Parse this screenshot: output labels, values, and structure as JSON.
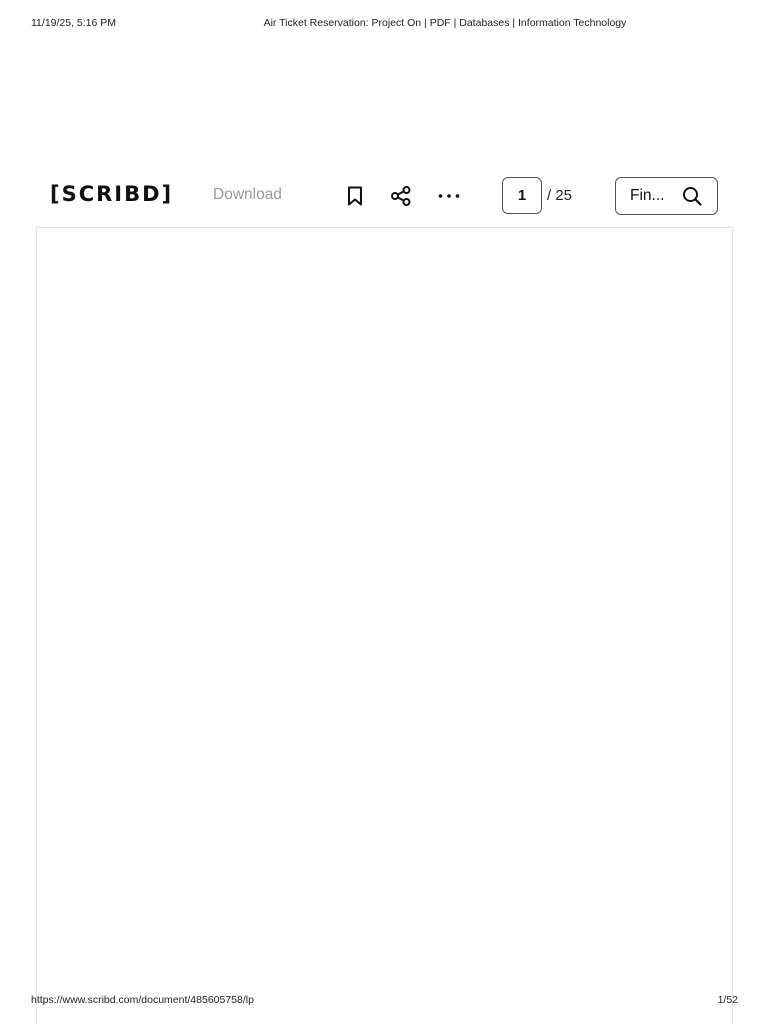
{
  "print_header": {
    "date": "11/19/25, 5:16 PM",
    "title": "Air Ticket Reservation: Project On | PDF | Databases | Information Technology"
  },
  "print_footer": {
    "url": "https://www.scribd.com/document/485605758/lp",
    "page": "1/52"
  },
  "toolbar": {
    "logo": "[SCRIBD]",
    "download_label": "Download",
    "icons": [
      "bookmark-icon",
      "share-icon",
      "more-icon",
      "search-icon"
    ],
    "page_current": "1",
    "page_total": "/ 25",
    "find_label": "Fin..."
  }
}
